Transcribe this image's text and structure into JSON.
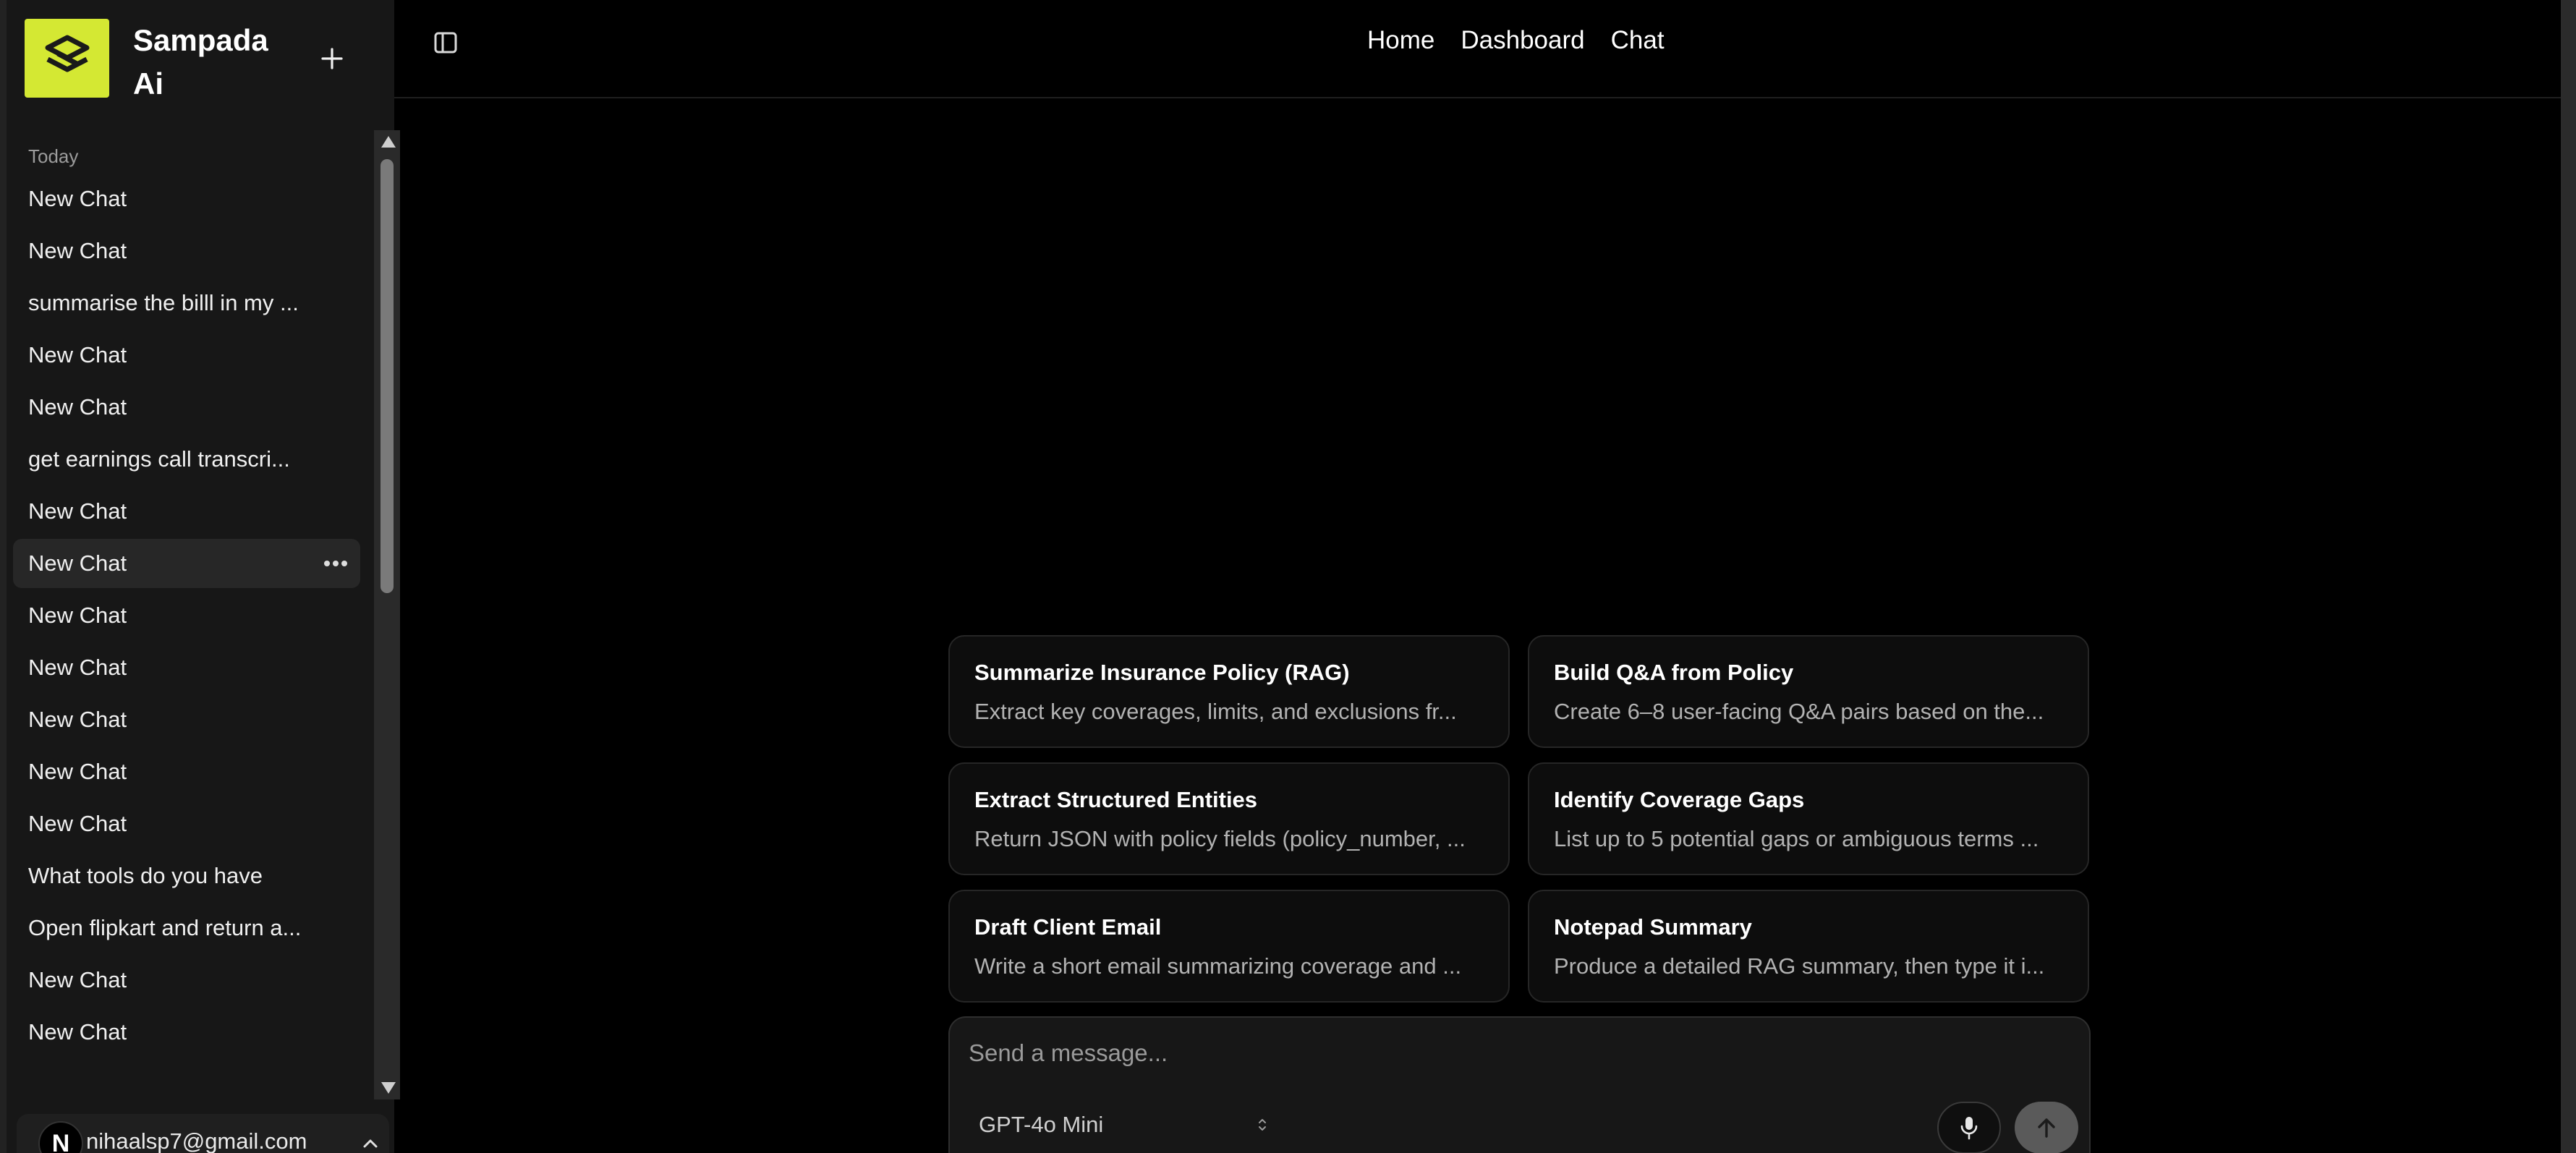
{
  "app": {
    "name": "Sampada Ai",
    "brand_color": "#d4e833"
  },
  "sidebar": {
    "section_label": "Today",
    "chats": [
      "New Chat",
      "New Chat",
      "summarise the billl in my ...",
      "New Chat",
      "New Chat",
      "get earnings call transcri...",
      "New Chat",
      "New Chat",
      "New Chat",
      "New Chat",
      "New Chat",
      "New Chat",
      "New Chat",
      "What tools do you have",
      "Open flipkart and return a...",
      "New Chat",
      "New Chat"
    ],
    "active_index": 7,
    "icons": {
      "new_chat": "plus-icon",
      "more": "more-horizontal-icon"
    }
  },
  "user": {
    "avatar_letter": "N",
    "email": "nihaalsp7@gmail.com"
  },
  "nav": {
    "items": [
      "Home",
      "Dashboard",
      "Chat"
    ]
  },
  "suggestions": [
    {
      "title": "Summarize Insurance Policy (RAG)",
      "desc": "Extract key coverages, limits, and exclusions fr..."
    },
    {
      "title": "Build Q&A from Policy",
      "desc": "Create 6–8 user-facing Q&A pairs based on the..."
    },
    {
      "title": "Extract Structured Entities",
      "desc": "Return JSON with policy fields (policy_number, ..."
    },
    {
      "title": "Identify Coverage Gaps",
      "desc": "List up to 5 potential gaps or ambiguous terms ..."
    },
    {
      "title": "Draft Client Email",
      "desc": "Write a short email summarizing coverage and ..."
    },
    {
      "title": "Notepad Summary",
      "desc": "Produce a detailed RAG summary, then type it i..."
    }
  ],
  "composer": {
    "placeholder": "Send a message...",
    "model": "GPT-4o Mini"
  }
}
